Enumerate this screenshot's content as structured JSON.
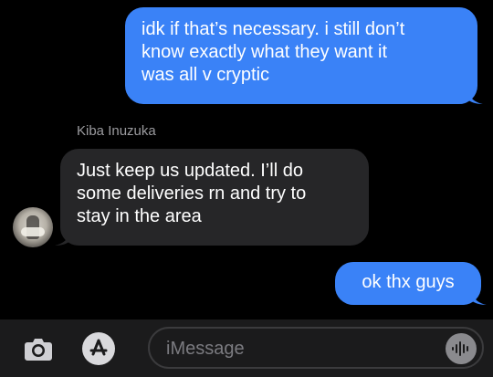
{
  "messages": {
    "outgoing_1": {
      "lines": [
        "idk if that’s necessary. i still don’t",
        "know exactly what they want it",
        "was all v cryptic"
      ]
    },
    "incoming_1": {
      "sender": "Kiba Inuzuka",
      "lines": [
        "Just keep us updated. I’ll do",
        "some deliveries rn and try to",
        "stay in the area"
      ]
    },
    "outgoing_2": {
      "text": "ok thx guys"
    }
  },
  "composer": {
    "placeholder": "iMessage",
    "value": ""
  },
  "icons": {
    "camera": "camera-icon",
    "apps": "app-store-icon",
    "audio": "audio-waveform-icon"
  },
  "colors": {
    "outgoing_bubble": "#3a82f7",
    "incoming_bubble": "#262628",
    "background": "#000000",
    "sender_label": "#9b9b9f"
  }
}
